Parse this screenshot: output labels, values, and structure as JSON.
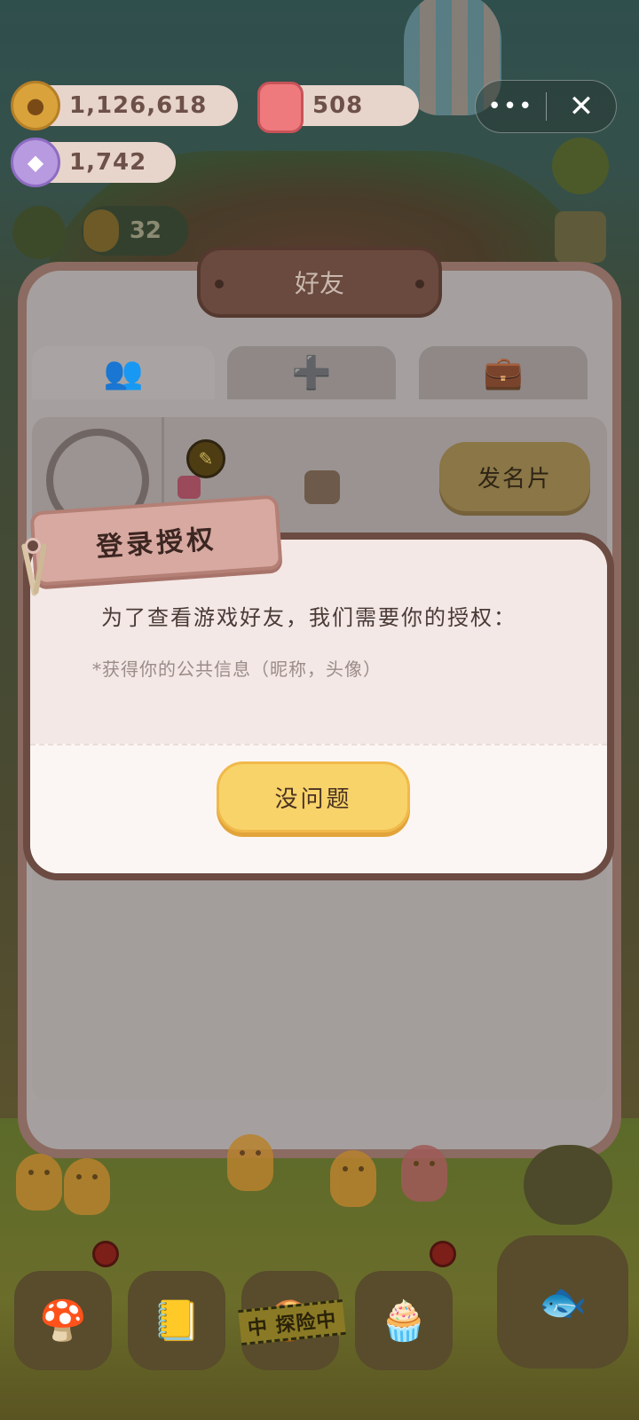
{
  "resources": {
    "coins": "1,126,618",
    "candles": "508",
    "gems": "1,742",
    "energy": "32"
  },
  "capsule": {
    "more_glyph": "•••",
    "close_glyph": "✕"
  },
  "friends_panel": {
    "title": "好友",
    "tabs": [
      {
        "name": "friends",
        "icon": "friends-icon"
      },
      {
        "name": "add-friend",
        "icon": "add-friend-icon"
      },
      {
        "name": "inventory",
        "icon": "briefcase-icon"
      }
    ],
    "card_button": "发名片"
  },
  "auth_dialog": {
    "tag_title": "登录授权",
    "message": "为了查看游戏好友，我们需要你的授权：",
    "detail": "*获得你的公共信息（昵称，头像）",
    "confirm_button": "没问题"
  },
  "dock": {
    "explore_label": "中 探险中"
  },
  "colors": {
    "confirm_button": "#f8d36a",
    "tag": "#d7a9a0",
    "dialog_frame": "#6c4b42"
  }
}
